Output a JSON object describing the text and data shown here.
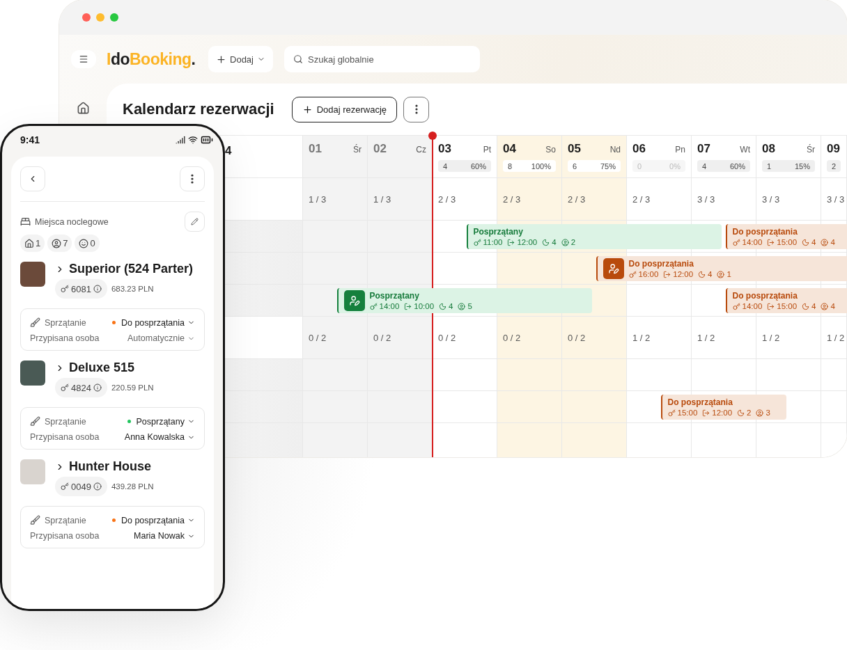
{
  "topbar": {
    "logo": [
      {
        "text": "I",
        "kind": "accent"
      },
      {
        "text": "do",
        "kind": "dark"
      },
      {
        "text": "Booking",
        "kind": "accent"
      },
      {
        "text": ".",
        "kind": "dark"
      }
    ],
    "add_button": "Dodaj",
    "search": {
      "placeholder": "Szukaj globalnie"
    }
  },
  "page": {
    "title": "Kalendarz rezerwacji",
    "add_button": "Dodaj rezerwację"
  },
  "calendar": {
    "corner_label": "4",
    "days": [
      {
        "day": "01",
        "weekday": "Śr",
        "past": true
      },
      {
        "day": "02",
        "weekday": "Cz",
        "past": true
      },
      {
        "day": "03",
        "weekday": "Pt",
        "count": "4",
        "occupancy": "60%",
        "past": false,
        "weekend": false,
        "today": true,
        "dimmed": false
      },
      {
        "day": "04",
        "weekday": "So",
        "count": "8",
        "occupancy": "100%",
        "past": false,
        "weekend": true,
        "today": false,
        "dimmed": false
      },
      {
        "day": "05",
        "weekday": "Nd",
        "count": "6",
        "occupancy": "75%",
        "past": false,
        "weekend": true,
        "today": false,
        "dimmed": false
      },
      {
        "day": "06",
        "weekday": "Pn",
        "count": "0",
        "occupancy": "0%",
        "past": false,
        "weekend": false,
        "today": false,
        "dimmed": true
      },
      {
        "day": "07",
        "weekday": "Wt",
        "count": "4",
        "occupancy": "60%",
        "past": false,
        "weekend": false,
        "today": false,
        "dimmed": false
      },
      {
        "day": "08",
        "weekday": "Śr",
        "count": "1",
        "occupancy": "15%",
        "past": false,
        "weekend": false,
        "today": false,
        "dimmed": false
      },
      {
        "day": "09",
        "count": "2",
        "past": false,
        "weekend": false,
        "today": false,
        "dimmed": false
      }
    ],
    "groups": [
      {
        "summary": [
          "1 / 3",
          "1 / 3",
          "2 / 3",
          "2 / 3",
          "2 / 3",
          "2 / 3",
          "3 / 3",
          "3 / 3",
          "3 / 3"
        ],
        "rows": [
          {
            "events": [
              {
                "kind": "clean",
                "title": "Posprzątany",
                "checkin": "11:00",
                "checkout": "12:00",
                "nights": "4",
                "guests": "2",
                "assigned": false
              },
              {
                "kind": "dirty",
                "title": "Do posprzątania",
                "checkin": "14:00",
                "checkout": "15:00",
                "nights": "4",
                "guests": "4",
                "assigned": false
              }
            ]
          },
          {
            "events": [
              {
                "kind": "dirty",
                "title": "Do posprzątania",
                "checkin": "16:00",
                "checkout": "12:00",
                "nights": "4",
                "guests": "1",
                "assigned": true
              }
            ]
          },
          {
            "events": [
              {
                "kind": "clean",
                "title": "Posprzątany",
                "checkin": "14:00",
                "checkout": "10:00",
                "nights": "4",
                "guests": "5",
                "assigned": true
              },
              {
                "kind": "dirty",
                "title": "Do posprzątania",
                "checkin": "14:00",
                "checkout": "15:00",
                "nights": "4",
                "guests": "4",
                "assigned": false
              }
            ]
          }
        ]
      },
      {
        "summary": [
          "0 / 2",
          "0 / 2",
          "0 / 2",
          "0 / 2",
          "0 / 2",
          "1 / 2",
          "1 / 2",
          "1 / 2",
          "1 / 2"
        ],
        "rows": [
          {
            "events": []
          },
          {
            "events": [
              {
                "kind": "dirty",
                "title": "Do posprzątania",
                "checkin": "15:00",
                "checkout": "12:00",
                "nights": "2",
                "guests": "3",
                "assigned": false
              }
            ]
          },
          {
            "events": []
          }
        ]
      }
    ]
  },
  "phone": {
    "time": "9:41",
    "section": {
      "title": "Miejsca noclegowe",
      "stats": [
        {
          "kind": "units",
          "value": "1"
        },
        {
          "kind": "adults",
          "value": "7"
        },
        {
          "kind": "children",
          "value": "0"
        }
      ]
    },
    "listings": [
      {
        "name": "Superior (524 Parter)",
        "code": "6081",
        "price": "683.23 PLN",
        "cleaning": {
          "label": "Sprzątanie",
          "status": "Do posprzątania",
          "color": "#f97316"
        },
        "assignee": {
          "label": "Przypisana osoba",
          "value": "Automatycznie",
          "automatic": true
        }
      },
      {
        "name": "Deluxe 515",
        "code": "4824",
        "price": "220.59 PLN",
        "cleaning": {
          "label": "Sprzątanie",
          "status": "Posprzątany",
          "color": "#22c55e"
        },
        "assignee": {
          "label": "Przypisana osoba",
          "value": "Anna Kowalska",
          "automatic": false
        }
      },
      {
        "name": "Hunter House",
        "code": "0049",
        "price": "439.28 PLN",
        "cleaning": {
          "label": "Sprzątanie",
          "status": "Do posprzątania",
          "color": "#f97316"
        },
        "assignee": {
          "label": "Przypisana osoba",
          "value": "Maria Nowak",
          "automatic": false
        }
      }
    ]
  }
}
